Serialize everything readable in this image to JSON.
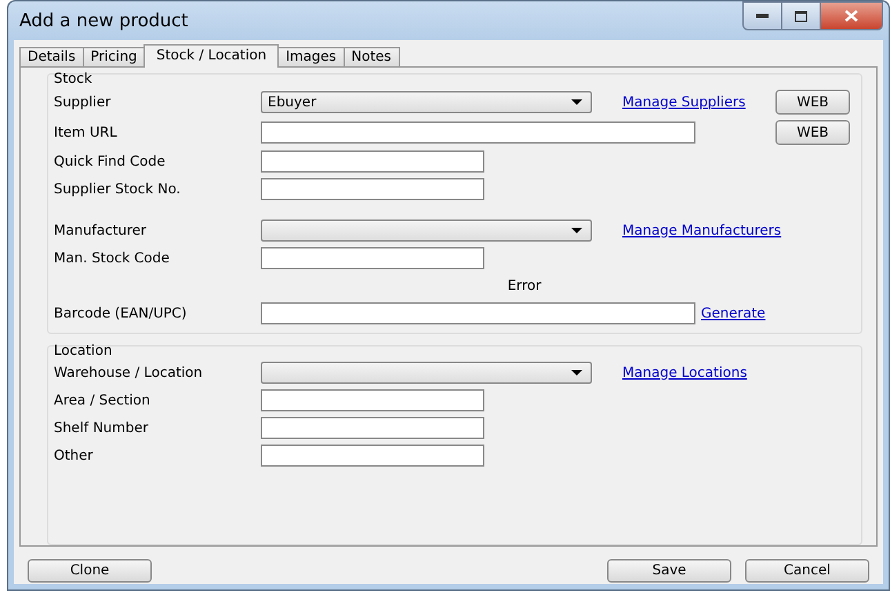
{
  "window": {
    "title": "Add a new product"
  },
  "tabs": [
    {
      "label": "Details",
      "selected": false
    },
    {
      "label": "Pricing",
      "selected": false
    },
    {
      "label": "Stock / Location",
      "selected": true
    },
    {
      "label": "Images",
      "selected": false
    },
    {
      "label": "Notes",
      "selected": false
    }
  ],
  "groups": [
    {
      "title": "Stock",
      "sections": [
        [
          {
            "label": "Supplier",
            "kind": "combo",
            "value": "Ebuyer",
            "link": "Manage Suppliers",
            "button": "WEB"
          },
          {
            "label": "Item URL",
            "kind": "wide-text",
            "button": "WEB"
          },
          {
            "label": "Quick Find Code",
            "kind": "text"
          },
          {
            "label": "Supplier Stock No.",
            "kind": "text"
          }
        ],
        [
          {
            "label": "Manufacturer",
            "kind": "combo",
            "link": "Manage Manufacturers"
          },
          {
            "label": "Man. Stock Code",
            "kind": "text"
          },
          {
            "label": "Barcode (EAN/UPC)",
            "kind": "wide-text",
            "note": "Error",
            "link": "Generate"
          }
        ]
      ]
    },
    {
      "title": "Location",
      "sections": [
        [
          {
            "label": "Warehouse / Location",
            "kind": "combo",
            "link": "Manage Locations"
          },
          {
            "label": "Area / Section",
            "kind": "text"
          },
          {
            "label": "Shelf Number",
            "kind": "text"
          },
          {
            "label": "Other",
            "kind": "text"
          }
        ]
      ]
    }
  ],
  "buttons_left": [
    "Clone"
  ],
  "buttons_right": [
    "Save",
    "Cancel"
  ]
}
